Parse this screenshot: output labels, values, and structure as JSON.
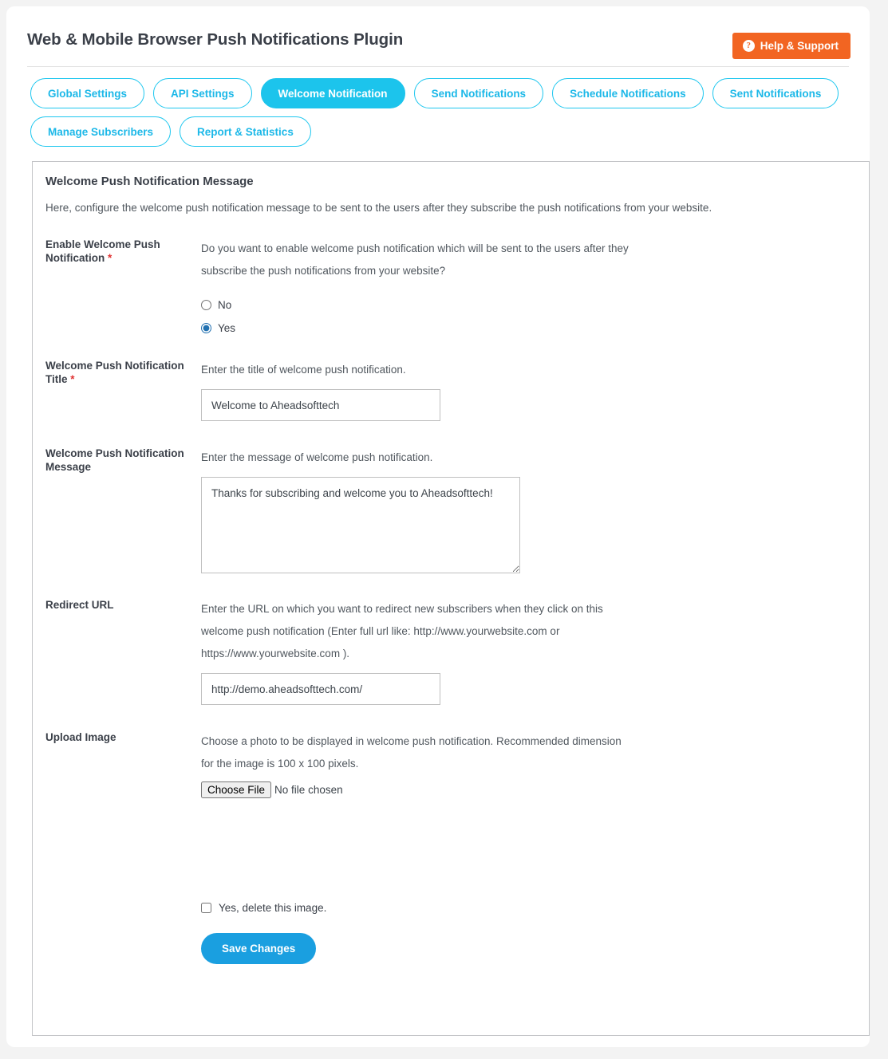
{
  "header": {
    "title": "Web & Mobile Browser Push Notifications Plugin",
    "help_label": "Help & Support",
    "help_icon": "question-mark-circle-icon"
  },
  "tabs": [
    {
      "label": "Global Settings",
      "active": false
    },
    {
      "label": "API Settings",
      "active": false
    },
    {
      "label": "Welcome Notification",
      "active": true
    },
    {
      "label": "Send Notifications",
      "active": false
    },
    {
      "label": "Schedule Notifications",
      "active": false
    },
    {
      "label": "Sent Notifications",
      "active": false
    },
    {
      "label": "Manage Subscribers",
      "active": false
    },
    {
      "label": "Report & Statistics",
      "active": false
    }
  ],
  "panel": {
    "title": "Welcome Push Notification Message",
    "description": "Here, configure the welcome push notification message to be sent to the users after they subscribe the push notifications from your website."
  },
  "fields": {
    "enable": {
      "label": "Enable Welcome Push Notification",
      "required_marker": "*",
      "description": "Do you want to enable welcome push notification which will be sent to the users after they subscribe the push notifications from your website?",
      "options": [
        {
          "label": "No",
          "value": "no",
          "selected": false
        },
        {
          "label": "Yes",
          "value": "yes",
          "selected": true
        }
      ]
    },
    "title": {
      "label": "Welcome Push Notification Title",
      "required_marker": "*",
      "description": "Enter the title of welcome push notification.",
      "value": "Welcome to Aheadsofttech"
    },
    "message": {
      "label": "Welcome Push Notification Message",
      "description": "Enter the message of welcome push notification.",
      "value": "Thanks for subscribing and welcome you to Aheadsofttech!"
    },
    "redirect_url": {
      "label": "Redirect URL",
      "description": "Enter the URL on which you want to redirect new subscribers when they click on this welcome push notification (Enter full url like: http://www.yourwebsite.com or https://www.yourwebsite.com ).",
      "value": "http://demo.aheadsofttech.com/"
    },
    "upload_image": {
      "label": "Upload Image",
      "description": "Choose a photo to be displayed in welcome push notification. Recommended dimension for the image is 100 x 100 pixels.",
      "button_label": "Choose File",
      "file_status": "No file chosen"
    },
    "delete_image": {
      "label": "Yes, delete this image.",
      "checked": false
    }
  },
  "actions": {
    "save_label": "Save Changes"
  },
  "colors": {
    "accent_cyan": "#1cc4ec",
    "accent_blue": "#1a9fe0",
    "help_orange": "#f26522",
    "required_red": "#e03333"
  }
}
